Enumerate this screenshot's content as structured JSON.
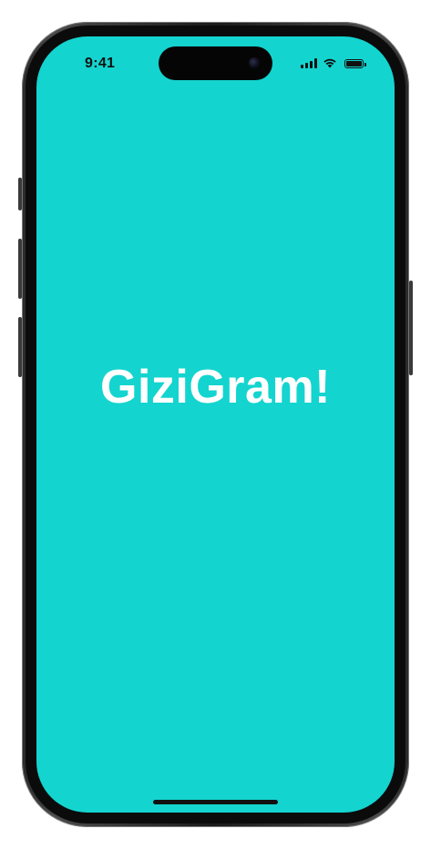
{
  "status_bar": {
    "time": "9:41",
    "icons": [
      "cellular-signal-icon",
      "wifi-icon",
      "battery-icon"
    ]
  },
  "splash": {
    "title": "GiziGram!"
  },
  "colors": {
    "background": "#14d4cf",
    "title": "#ffffff",
    "status_text": "#111111"
  }
}
